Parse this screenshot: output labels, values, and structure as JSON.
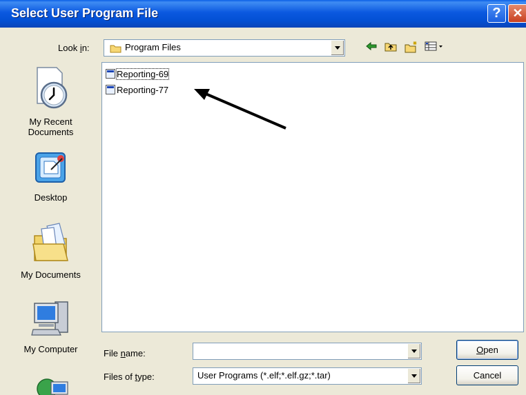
{
  "window": {
    "title": "Select User Program File",
    "help_label": "?",
    "close_label": "✕"
  },
  "lookin": {
    "label_pre": "Look ",
    "label_key": "i",
    "label_post": "n:",
    "value": "Program Files"
  },
  "toolbar": {
    "back_icon": "back-arrow-icon",
    "up_icon": "up-folder-icon",
    "newfolder_icon": "new-folder-icon",
    "views_icon": "views-menu-icon"
  },
  "places": [
    {
      "label": "My Recent\nDocuments",
      "icon": "recent-documents-icon"
    },
    {
      "label": "Desktop",
      "icon": "desktop-icon"
    },
    {
      "label": "My Documents",
      "icon": "my-documents-icon"
    },
    {
      "label": "My Computer",
      "icon": "my-computer-icon"
    },
    {
      "label": "",
      "icon": "network-places-icon"
    }
  ],
  "files": [
    {
      "name": "Reporting-69"
    },
    {
      "name": "Reporting-77"
    }
  ],
  "filename": {
    "label_pre": "File ",
    "label_key": "n",
    "label_post": "ame:",
    "value": ""
  },
  "filetype": {
    "label_pre": "Files of ",
    "label_key": "t",
    "label_post": "ype:",
    "value": "User Programs (*.elf;*.elf.gz;*.tar)"
  },
  "buttons": {
    "open_key": "O",
    "open_rest": "pen",
    "cancel": "Cancel"
  }
}
